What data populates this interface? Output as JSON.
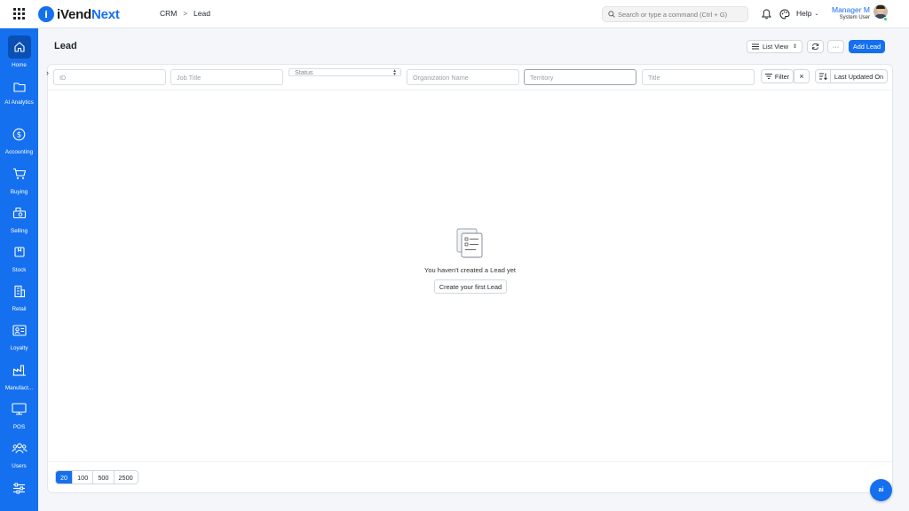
{
  "app": {
    "logo_mark": "i",
    "logo_prefix": "iVend",
    "logo_suffix": "Next",
    "brand_color": "#1570ef"
  },
  "breadcrumb": {
    "items": [
      "CRM",
      "Lead"
    ],
    "separator": ">"
  },
  "search": {
    "placeholder": "Search or type a command (Ctrl + G)"
  },
  "header_icons": [
    "notification-bell-icon",
    "palette-icon"
  ],
  "help": {
    "label": "Help"
  },
  "user": {
    "name": "Manager M",
    "role": "System User",
    "status": "online"
  },
  "sidebar": {
    "items": [
      {
        "label": "Home",
        "icon": "home-icon",
        "active": true
      },
      {
        "label": "AI Analytics",
        "icon": "folder-icon",
        "active": false
      },
      {
        "label": "Accounting",
        "icon": "dollar-circle-icon",
        "active": false
      },
      {
        "label": "Buying",
        "icon": "cart-icon",
        "active": false
      },
      {
        "label": "Selling",
        "icon": "register-icon",
        "active": false
      },
      {
        "label": "Stock",
        "icon": "box-icon",
        "active": false
      },
      {
        "label": "Retail",
        "icon": "store-icon",
        "active": false
      },
      {
        "label": "Loyalty",
        "icon": "id-card-icon",
        "active": false
      },
      {
        "label": "Manufact...",
        "icon": "factory-icon",
        "active": false
      },
      {
        "label": "POS",
        "icon": "monitor-icon",
        "active": false
      },
      {
        "label": "Users",
        "icon": "users-icon",
        "active": false
      },
      {
        "label": "",
        "icon": "settings-sliders-icon",
        "active": false
      }
    ]
  },
  "page": {
    "title": "Lead",
    "list_view_label": "List View",
    "more_label": "···",
    "add_label": "Add Lead"
  },
  "filters": {
    "id": "ID",
    "job_title": "Job Title",
    "status": "Status",
    "organization": "Organization Name",
    "territory": "Territory",
    "title": "Title",
    "filter_label": "Filter",
    "clear_label": "×",
    "sort_label": "Last Updated On"
  },
  "empty_state": {
    "message": "You haven't created a Lead yet",
    "button": "Create your first Lead"
  },
  "paging": {
    "sizes": [
      "20",
      "100",
      "500",
      "2500"
    ],
    "selected": "20"
  },
  "ai_button": {
    "label": "ai"
  }
}
